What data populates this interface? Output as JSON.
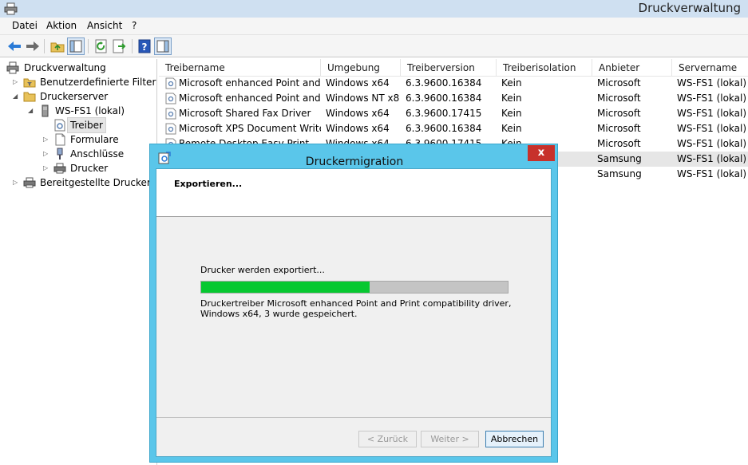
{
  "window": {
    "title": "Druckverwaltung",
    "app_icon": "printer-icon"
  },
  "menu": {
    "items": [
      "Datei",
      "Aktion",
      "Ansicht",
      "?"
    ]
  },
  "toolbar": {
    "icons": [
      "back-arrow-icon",
      "forward-arrow-icon",
      "up-folder-icon",
      "show-hide-console-tree-icon",
      "refresh-icon",
      "export-list-icon",
      "help-icon",
      "show-hide-action-pane-icon"
    ]
  },
  "tree": {
    "items": [
      {
        "label": "Druckverwaltung",
        "icon": "printer-icon"
      },
      {
        "label": "Benutzerdefinierte Filter",
        "icon": "filter-folder-icon"
      },
      {
        "label": "Druckerserver",
        "icon": "folder-icon"
      },
      {
        "label": "WS-FS1 (lokal)",
        "icon": "server-icon"
      },
      {
        "label": "Treiber",
        "icon": "driver-icon"
      },
      {
        "label": "Formulare",
        "icon": "form-icon"
      },
      {
        "label": "Anschlüsse",
        "icon": "port-icon"
      },
      {
        "label": "Drucker",
        "icon": "printer-icon"
      },
      {
        "label": "Bereitgestellte Drucker",
        "icon": "printer-icon"
      }
    ]
  },
  "list": {
    "columns": [
      "Treibername",
      "Umgebung",
      "Treiberversion",
      "Treiberisolation",
      "Anbieter",
      "Servername"
    ],
    "rows": [
      [
        "Microsoft enhanced Point and ...",
        "Windows x64",
        "6.3.9600.16384",
        "Kein",
        "Microsoft",
        "WS-FS1 (lokal)"
      ],
      [
        "Microsoft enhanced Point and ...",
        "Windows NT x86",
        "6.3.9600.16384",
        "Kein",
        "Microsoft",
        "WS-FS1 (lokal)"
      ],
      [
        "Microsoft Shared Fax Driver",
        "Windows x64",
        "6.3.9600.17415",
        "Kein",
        "Microsoft",
        "WS-FS1 (lokal)"
      ],
      [
        "Microsoft XPS Document Write...",
        "Windows x64",
        "6.3.9600.16384",
        "Kein",
        "Microsoft",
        "WS-FS1 (lokal)"
      ],
      [
        "Remote Desktop Easy Print",
        "Windows x64",
        "6.3.9600.17415",
        "Kein",
        "Microsoft",
        "WS-FS1 (lokal)"
      ],
      [
        "",
        "",
        "",
        "",
        "Samsung",
        "WS-FS1 (lokal)"
      ],
      [
        "",
        "",
        "",
        "",
        "Samsung",
        "WS-FS1 (lokal)"
      ]
    ]
  },
  "dialog": {
    "title": "Druckermigration",
    "close_label": "x",
    "heading": "Exportieren...",
    "status": "Drucker werden exportiert...",
    "progress": 0.55,
    "progress_color": "#06c830",
    "detail": "Druckertreiber Microsoft enhanced Point and Print compatibility driver, Windows x64, 3 wurde gespeichert.",
    "buttons": {
      "back": "< Zurück",
      "next": "Weiter >",
      "cancel": "Abbrechen"
    }
  }
}
